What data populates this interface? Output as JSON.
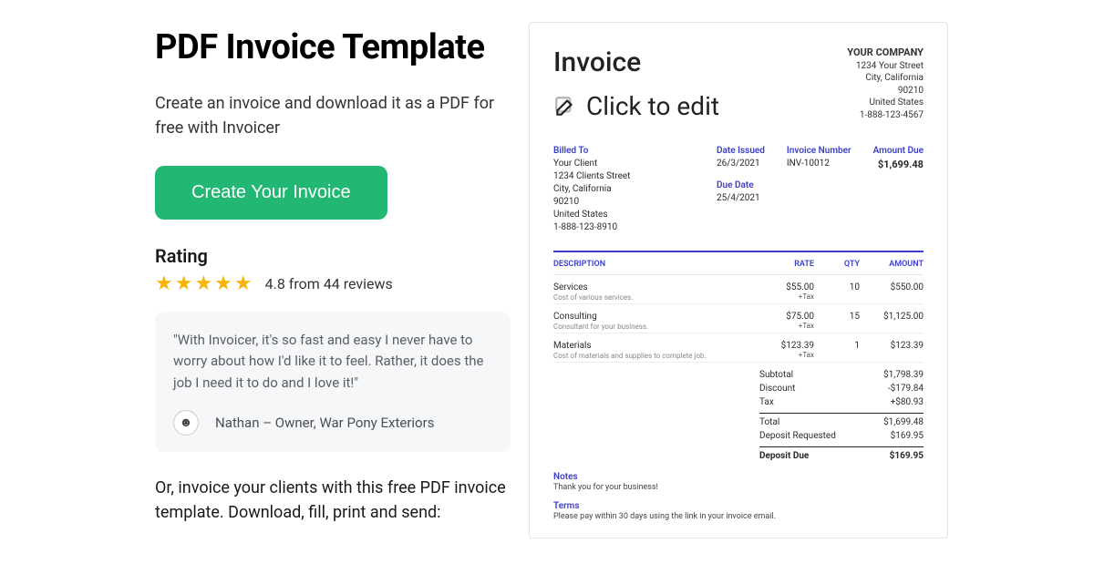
{
  "title": "PDF Invoice Template",
  "subtitle": "Create an invoice and download it as a PDF for free with Invoicer",
  "cta": "Create Your Invoice",
  "rating": {
    "label": "Rating",
    "stars": "★★★★★",
    "text": "4.8 from 44 reviews"
  },
  "review": {
    "text": "\"With Invoicer, it's so fast and easy I never have to worry about how I'd like it to feel. Rather, it does the job I need it to do and I love it!\"",
    "author": "Nathan – Owner, War Pony Exteriors"
  },
  "alt_text": "Or, invoice your clients with this free PDF invoice template. Download, fill, print and send:",
  "invoice": {
    "heading": "Invoice",
    "edit_label": "Click to edit",
    "company": {
      "name": "YOUR COMPANY",
      "street": "1234 Your Street",
      "city": "City, California",
      "zip": "90210",
      "country": "United States",
      "phone": "1-888-123-4567"
    },
    "billed_label": "Billed To",
    "client": {
      "name": "Your Client",
      "street": "1234 Clients Street",
      "city": "City, California",
      "zip": "90210",
      "country": "United States",
      "phone": "1-888-123-8910"
    },
    "date_issued_label": "Date Issued",
    "date_issued": "26/3/2021",
    "due_date_label": "Due Date",
    "due_date": "25/4/2021",
    "invoice_number_label": "Invoice Number",
    "invoice_number": "INV-10012",
    "amount_due_label": "Amount Due",
    "amount_due": "$1,699.48",
    "cols": {
      "desc": "DESCRIPTION",
      "rate": "RATE",
      "qty": "QTY",
      "amount": "AMOUNT"
    },
    "lines": [
      {
        "name": "Services",
        "sub": "Cost of various services.",
        "rate": "$55.00",
        "tax": "+Tax",
        "qty": "10",
        "amount": "$550.00"
      },
      {
        "name": "Consulting",
        "sub": "Consultant for your business.",
        "rate": "$75.00",
        "tax": "+Tax",
        "qty": "15",
        "amount": "$1,125.00"
      },
      {
        "name": "Materials",
        "sub": "Cost of materials and supplies to complete job.",
        "rate": "$123.39",
        "tax": "+Tax",
        "qty": "1",
        "amount": "$123.39"
      }
    ],
    "totals": {
      "subtotal_label": "Subtotal",
      "subtotal": "$1,798.39",
      "discount_label": "Discount",
      "discount": "-$179.84",
      "tax_label": "Tax",
      "tax": "+$80.93",
      "total_label": "Total",
      "total": "$1,699.48",
      "deposit_req_label": "Deposit Requested",
      "deposit_req": "$169.95",
      "deposit_due_label": "Deposit Due",
      "deposit_due": "$169.95"
    },
    "notes_label": "Notes",
    "notes": "Thank you for your business!",
    "terms_label": "Terms",
    "terms": "Please pay within 30 days using the link in your invoice email."
  }
}
